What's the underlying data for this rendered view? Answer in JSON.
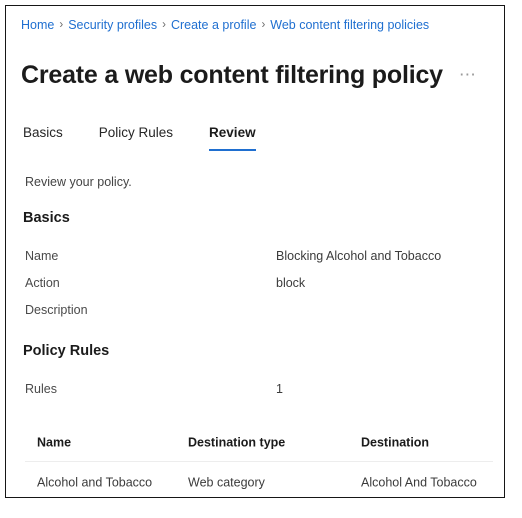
{
  "breadcrumb": {
    "separator": "›",
    "items": [
      {
        "label": "Home"
      },
      {
        "label": "Security profiles"
      },
      {
        "label": "Create a profile"
      },
      {
        "label": "Web content filtering policies"
      }
    ]
  },
  "header": {
    "title": "Create a web content filtering policy",
    "more_actions_label": "⋯"
  },
  "tabs": [
    {
      "label": "Basics",
      "active": false
    },
    {
      "label": "Policy Rules",
      "active": false
    },
    {
      "label": "Review",
      "active": true
    }
  ],
  "main": {
    "subtitle": "Review your policy.",
    "basics": {
      "heading": "Basics",
      "fields": [
        {
          "label": "Name",
          "value": "Blocking Alcohol and Tobacco"
        },
        {
          "label": "Action",
          "value": "block"
        },
        {
          "label": "Description",
          "value": ""
        }
      ]
    },
    "policy_rules": {
      "heading": "Policy Rules",
      "fields": [
        {
          "label": "Rules",
          "value": "1"
        }
      ],
      "table": {
        "columns": [
          "Name",
          "Destination type",
          "Destination"
        ],
        "rows": [
          [
            "Alcohol and Tobacco",
            "Web category",
            "Alcohol And Tobacco"
          ]
        ]
      }
    }
  },
  "colors": {
    "link": "#1f6fd0",
    "accent": "#1f6fd0",
    "text": "#1b1b1b",
    "muted": "#4a4a4a",
    "border": "#161616",
    "row_divider": "#ededed"
  }
}
